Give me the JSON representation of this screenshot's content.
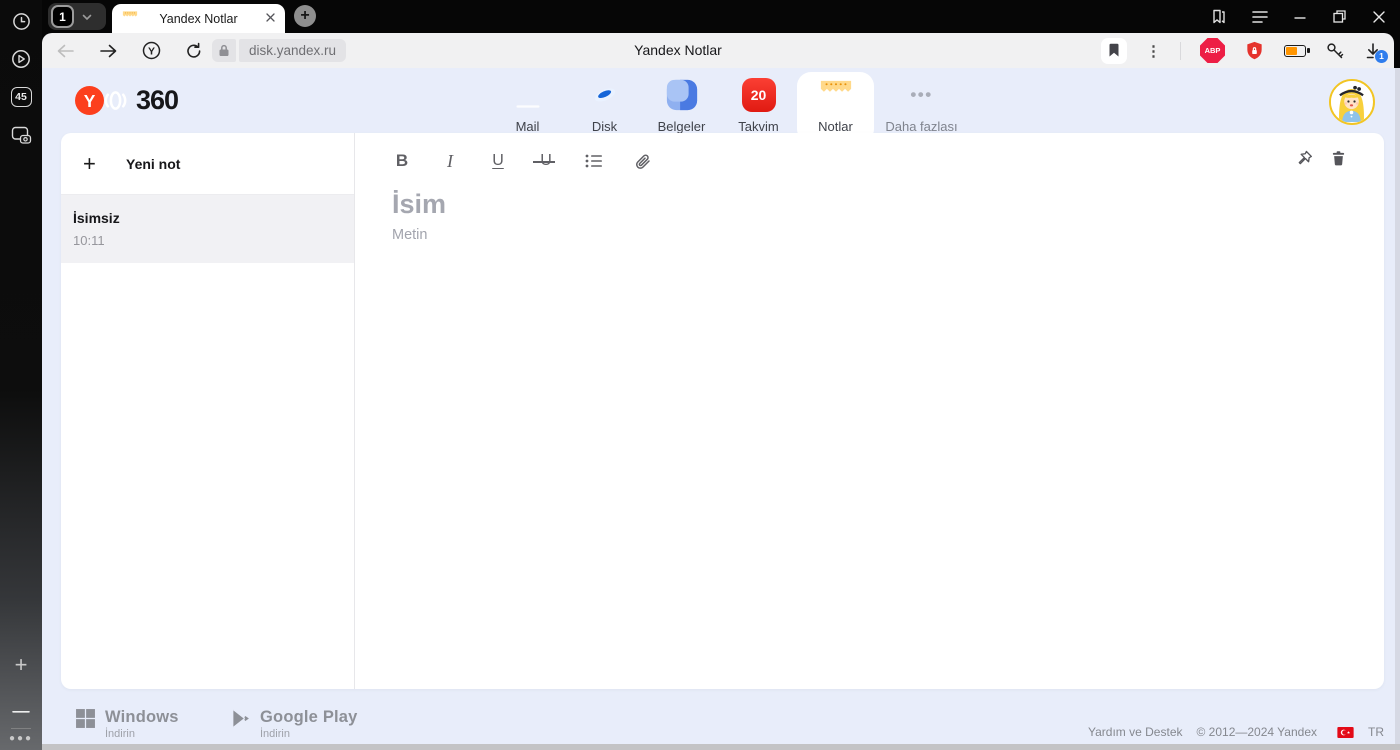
{
  "colors": {
    "accent_lavender": "#e8edfa",
    "yandex_red": "#fc3f1d",
    "takvim_red": "#ec241c",
    "notlar_orange": "#ffa31a"
  },
  "os_sidebar": {
    "score_badge": "45"
  },
  "browser": {
    "tab_group_count": "1",
    "tab": {
      "title": "Yandex Notlar"
    },
    "address": {
      "url": "disk.yandex.ru",
      "page_title": "Yandex Notlar"
    },
    "extensions": {
      "abp_label": "ABP",
      "download_badge": "1"
    }
  },
  "header": {
    "logo_letter": "Y",
    "logo_suffix": "360",
    "apps": [
      {
        "label": "Mail"
      },
      {
        "label": "Disk"
      },
      {
        "label": "Belgeler"
      },
      {
        "label": "Takvim",
        "badge": "20"
      },
      {
        "label": "Notlar",
        "active": true
      },
      {
        "label": "Daha fazlası"
      }
    ]
  },
  "notes_panel": {
    "new_note_label": "Yeni not",
    "notes": [
      {
        "title": "İsimsiz",
        "time": "10:11",
        "selected": true
      }
    ]
  },
  "editor": {
    "title_placeholder": "İsim",
    "body_placeholder": "Metin",
    "toolbar": {
      "bold": "B",
      "italic": "I",
      "underline": "U",
      "strikethrough": "U"
    }
  },
  "footer": {
    "downloads": [
      {
        "platform": "Windows",
        "action": "İndirin"
      },
      {
        "platform": "Google Play",
        "action": "İndirin"
      }
    ],
    "help_link": "Yardım ve Destek",
    "copyright": "© 2012—2024 Yandex",
    "language": "TR"
  }
}
